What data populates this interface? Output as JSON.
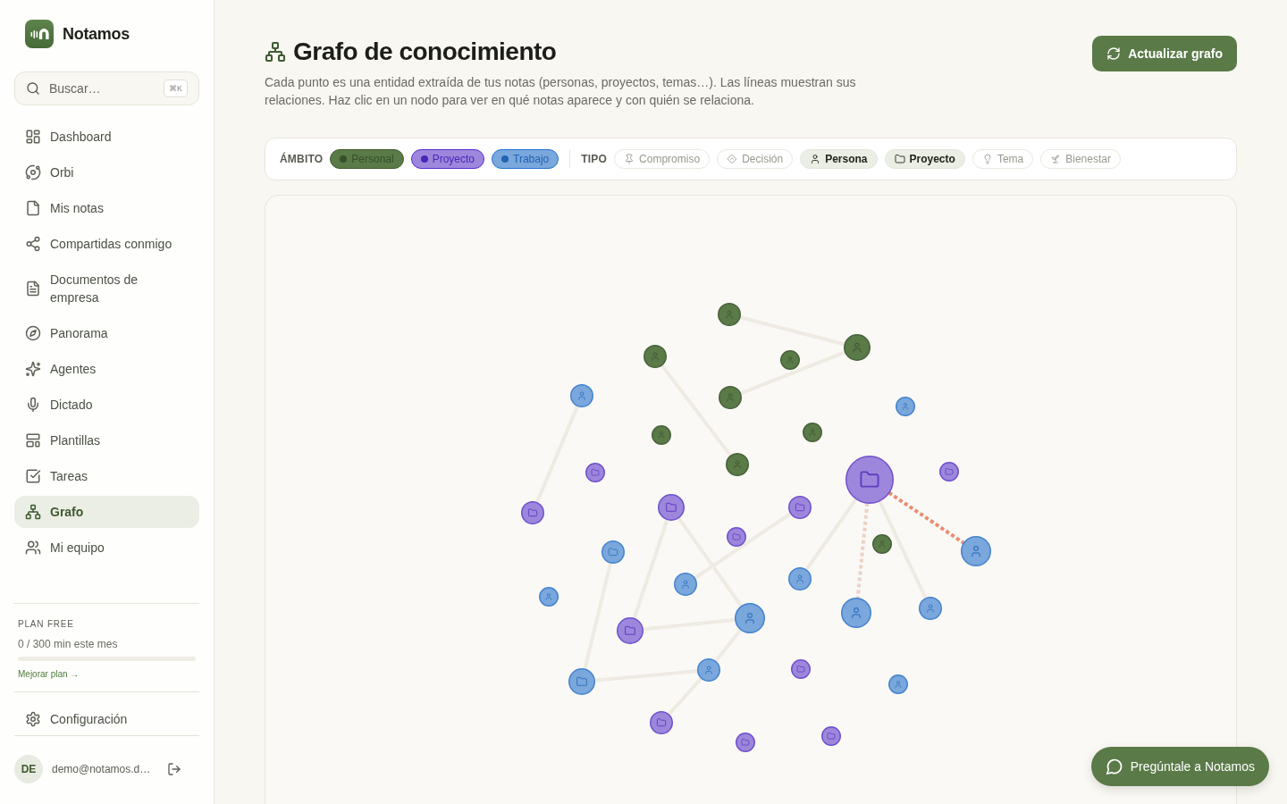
{
  "sidebar": {
    "brand": "Notamos",
    "search": {
      "placeholder": "Buscar…",
      "shortcut": "⌘K"
    },
    "nav": [
      {
        "label": "Dashboard",
        "selected": false
      },
      {
        "label": "Orbi",
        "selected": false
      },
      {
        "label": "Mis notas",
        "selected": false
      },
      {
        "label": "Compartidas conmigo",
        "selected": false
      },
      {
        "label": "Documentos de empresa",
        "selected": false
      },
      {
        "label": "Panorama",
        "selected": false
      },
      {
        "label": "Agentes",
        "selected": false
      },
      {
        "label": "Dictado",
        "selected": false
      },
      {
        "label": "Plantillas",
        "selected": false
      },
      {
        "label": "Tareas",
        "selected": false
      },
      {
        "label": "Grafo",
        "selected": true
      },
      {
        "label": "Mi equipo",
        "selected": false
      }
    ],
    "plan": {
      "title": "PLAN FREE",
      "usage": "0 / 300 min este mes",
      "level": 0,
      "upgrade_link": "Mejorar plan →"
    },
    "settings": {
      "label": "Configuración"
    },
    "user": {
      "initials": "DE",
      "email": "demo@notamos.d…"
    }
  },
  "header": {
    "title": "Grafo de conocimiento",
    "description": "Cada punto es una entidad extraída de tus notas (personas, proyectos, temas…). Las líneas muestran sus relaciones. Haz clic en un nodo para ver en qué notas aparece y con quién se relaciona.",
    "refresh_button": "Actualizar grafo"
  },
  "filters": {
    "scope_label": "ÁMBITO",
    "scope": [
      {
        "label": "Personal",
        "color": "#5a7a48",
        "selected": true
      },
      {
        "label": "Proyecto",
        "color": "#9d87dc",
        "selected": true
      },
      {
        "label": "Trabajo",
        "color": "#7aa7dc",
        "selected": true
      }
    ],
    "type_label": "TIPO",
    "types": [
      {
        "label": "Compromiso",
        "selected": false
      },
      {
        "label": "Decisión",
        "selected": false
      },
      {
        "label": "Persona",
        "selected": true
      },
      {
        "label": "Proyecto",
        "selected": true
      },
      {
        "label": "Tema",
        "selected": false
      },
      {
        "label": "Bienestar",
        "selected": false
      }
    ]
  },
  "graph": {
    "nodes": [
      {
        "kind": "persona",
        "color": "#5a7a48"
      },
      {
        "kind": "persona",
        "color": "#5a7a48"
      },
      {
        "kind": "persona",
        "color": "#5a7a48"
      },
      {
        "kind": "persona",
        "color": "#5a7a48"
      },
      {
        "kind": "persona",
        "color": "#7aa7dc"
      },
      {
        "kind": "persona",
        "color": "#5a7a48"
      },
      {
        "kind": "persona",
        "color": "#7aa7dc"
      },
      {
        "kind": "persona",
        "color": "#5a7a48"
      },
      {
        "kind": "persona",
        "color": "#5a7a48"
      },
      {
        "kind": "persona",
        "color": "#5a7a48"
      },
      {
        "kind": "proyecto",
        "color": "#9d87dc"
      },
      {
        "kind": "proyecto",
        "color": "#9d87dc"
      },
      {
        "kind": "proyecto",
        "color": "#9d87dc"
      },
      {
        "kind": "proyecto",
        "color": "#9d87dc"
      },
      {
        "kind": "proyecto",
        "color": "#9d87dc"
      },
      {
        "kind": "proyecto",
        "color": "#9d87dc"
      },
      {
        "kind": "proyecto",
        "color": "#9d87dc"
      },
      {
        "kind": "persona",
        "color": "#5a7a48"
      },
      {
        "kind": "persona",
        "color": "#7aa7dc"
      },
      {
        "kind": "proyecto",
        "color": "#7aa7dc"
      },
      {
        "kind": "persona",
        "color": "#7aa7dc"
      },
      {
        "kind": "persona",
        "color": "#7aa7dc"
      },
      {
        "kind": "persona",
        "color": "#7aa7dc"
      },
      {
        "kind": "persona",
        "color": "#7aa7dc"
      },
      {
        "kind": "persona",
        "color": "#7aa7dc"
      },
      {
        "kind": "persona",
        "color": "#7aa7dc"
      },
      {
        "kind": "proyecto",
        "color": "#9d87dc"
      },
      {
        "kind": "proyecto",
        "color": "#9d87dc"
      },
      {
        "kind": "persona",
        "color": "#7aa7dc"
      },
      {
        "kind": "proyecto",
        "color": "#7aa7dc"
      },
      {
        "kind": "persona",
        "color": "#7aa7dc"
      },
      {
        "kind": "proyecto",
        "color": "#9d87dc"
      },
      {
        "kind": "proyecto",
        "color": "#9d87dc"
      },
      {
        "kind": "proyecto",
        "color": "#9d87dc"
      }
    ],
    "edges": [
      {
        "kind": "plain"
      },
      {
        "kind": "plain"
      },
      {
        "kind": "plain"
      },
      {
        "kind": "plain"
      },
      {
        "kind": "strong"
      },
      {
        "kind": "plain"
      },
      {
        "kind": "weak"
      },
      {
        "kind": "plain"
      },
      {
        "kind": "plain"
      },
      {
        "kind": "plain"
      },
      {
        "kind": "plain"
      },
      {
        "kind": "plain"
      },
      {
        "kind": "plain"
      },
      {
        "kind": "plain"
      },
      {
        "kind": "plain"
      },
      {
        "kind": "plain"
      }
    ]
  },
  "assistant_button": "Pregúntale a Notamos"
}
